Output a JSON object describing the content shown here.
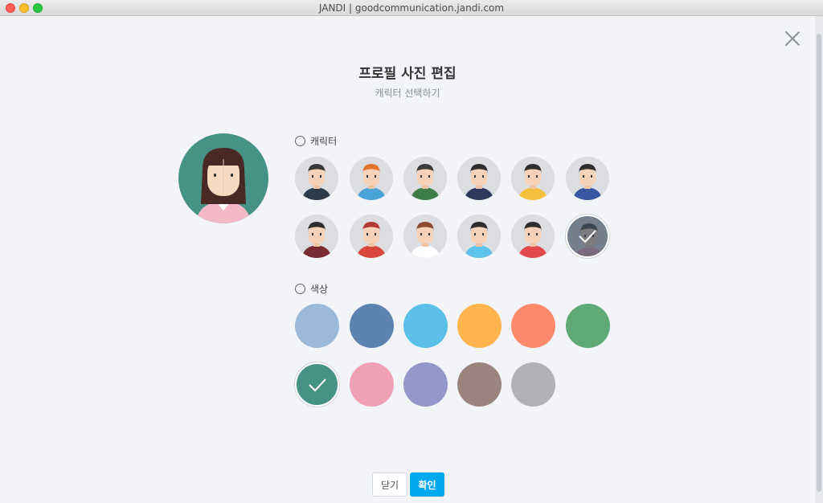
{
  "window": {
    "title": "JANDI | goodcommunication.jandi.com"
  },
  "dialog": {
    "title": "프로필 사진 편집",
    "subtitle": "캐릭터 선택하기",
    "close_icon": "close-icon"
  },
  "sections": {
    "character_label": "캐릭터",
    "color_label": "색상"
  },
  "characters": [
    {
      "name": "character-mustache-man",
      "skin": "#f6d3b8",
      "hair": "#3a3a3a",
      "shirt": "#2d3a4a",
      "selected": false
    },
    {
      "name": "character-redhead-girl",
      "skin": "#f6d3b8",
      "hair": "#e2732d",
      "shirt": "#4aa3d9",
      "selected": false
    },
    {
      "name": "character-glasses-man",
      "skin": "#f6d3b8",
      "hair": "#3a3a3a",
      "shirt": "#3e7d4a",
      "selected": false
    },
    {
      "name": "character-suit-man",
      "skin": "#f6d3b8",
      "hair": "#2e2e2e",
      "shirt": "#2d3a5e",
      "selected": false
    },
    {
      "name": "character-crown-girl",
      "skin": "#f6d3b8",
      "hair": "#2e2e2e",
      "shirt": "#f4c03b",
      "selected": false
    },
    {
      "name": "character-hat-man",
      "skin": "#f6d3b8",
      "hair": "#2e2e2e",
      "shirt": "#3857a3",
      "selected": false
    },
    {
      "name": "character-glasses-man-2",
      "skin": "#f6d3b8",
      "hair": "#2e2e2e",
      "shirt": "#7a2a33",
      "selected": false
    },
    {
      "name": "character-chef-man",
      "skin": "#f6d3b8",
      "hair": "#b23a34",
      "shirt": "#d9463e",
      "selected": false
    },
    {
      "name": "character-brown-hair-girl",
      "skin": "#f6d3b8",
      "hair": "#8a4b2c",
      "shirt": "#ffffff",
      "selected": false
    },
    {
      "name": "character-hanbok-girl",
      "skin": "#f6d3b8",
      "hair": "#2e2e2e",
      "shirt": "#5cc4ea",
      "selected": false
    },
    {
      "name": "character-bun-girl",
      "skin": "#f6d3b8",
      "hair": "#2e2e2e",
      "shirt": "#e3484c",
      "selected": false
    },
    {
      "name": "character-long-hair-girl",
      "skin": "#f6d3b8",
      "hair": "#3a3a3a",
      "shirt": "#e9a2b5",
      "selected": true
    }
  ],
  "colors": [
    {
      "name": "color-light-blue",
      "hex": "#9bbad9",
      "selected": false
    },
    {
      "name": "color-steel-blue",
      "hex": "#5d83b0",
      "selected": false
    },
    {
      "name": "color-sky-blue",
      "hex": "#5ac0e8",
      "selected": false
    },
    {
      "name": "color-orange",
      "hex": "#ffb44d",
      "selected": false
    },
    {
      "name": "color-coral",
      "hex": "#ff8a6b",
      "selected": false
    },
    {
      "name": "color-green",
      "hex": "#5ea975",
      "selected": false
    },
    {
      "name": "color-teal",
      "hex": "#469386",
      "selected": true
    },
    {
      "name": "color-pink",
      "hex": "#f0a0b5",
      "selected": false
    },
    {
      "name": "color-lavender",
      "hex": "#9596c9",
      "selected": false
    },
    {
      "name": "color-taupe",
      "hex": "#9b847e",
      "selected": false
    },
    {
      "name": "color-gray",
      "hex": "#b0b2b6",
      "selected": false
    }
  ],
  "preview": {
    "background": "#469386",
    "skin": "#f9d9c0",
    "hair": "#4a2824",
    "shirt": "#f4b9c6"
  },
  "buttons": {
    "cancel": "닫기",
    "confirm": "확인"
  }
}
